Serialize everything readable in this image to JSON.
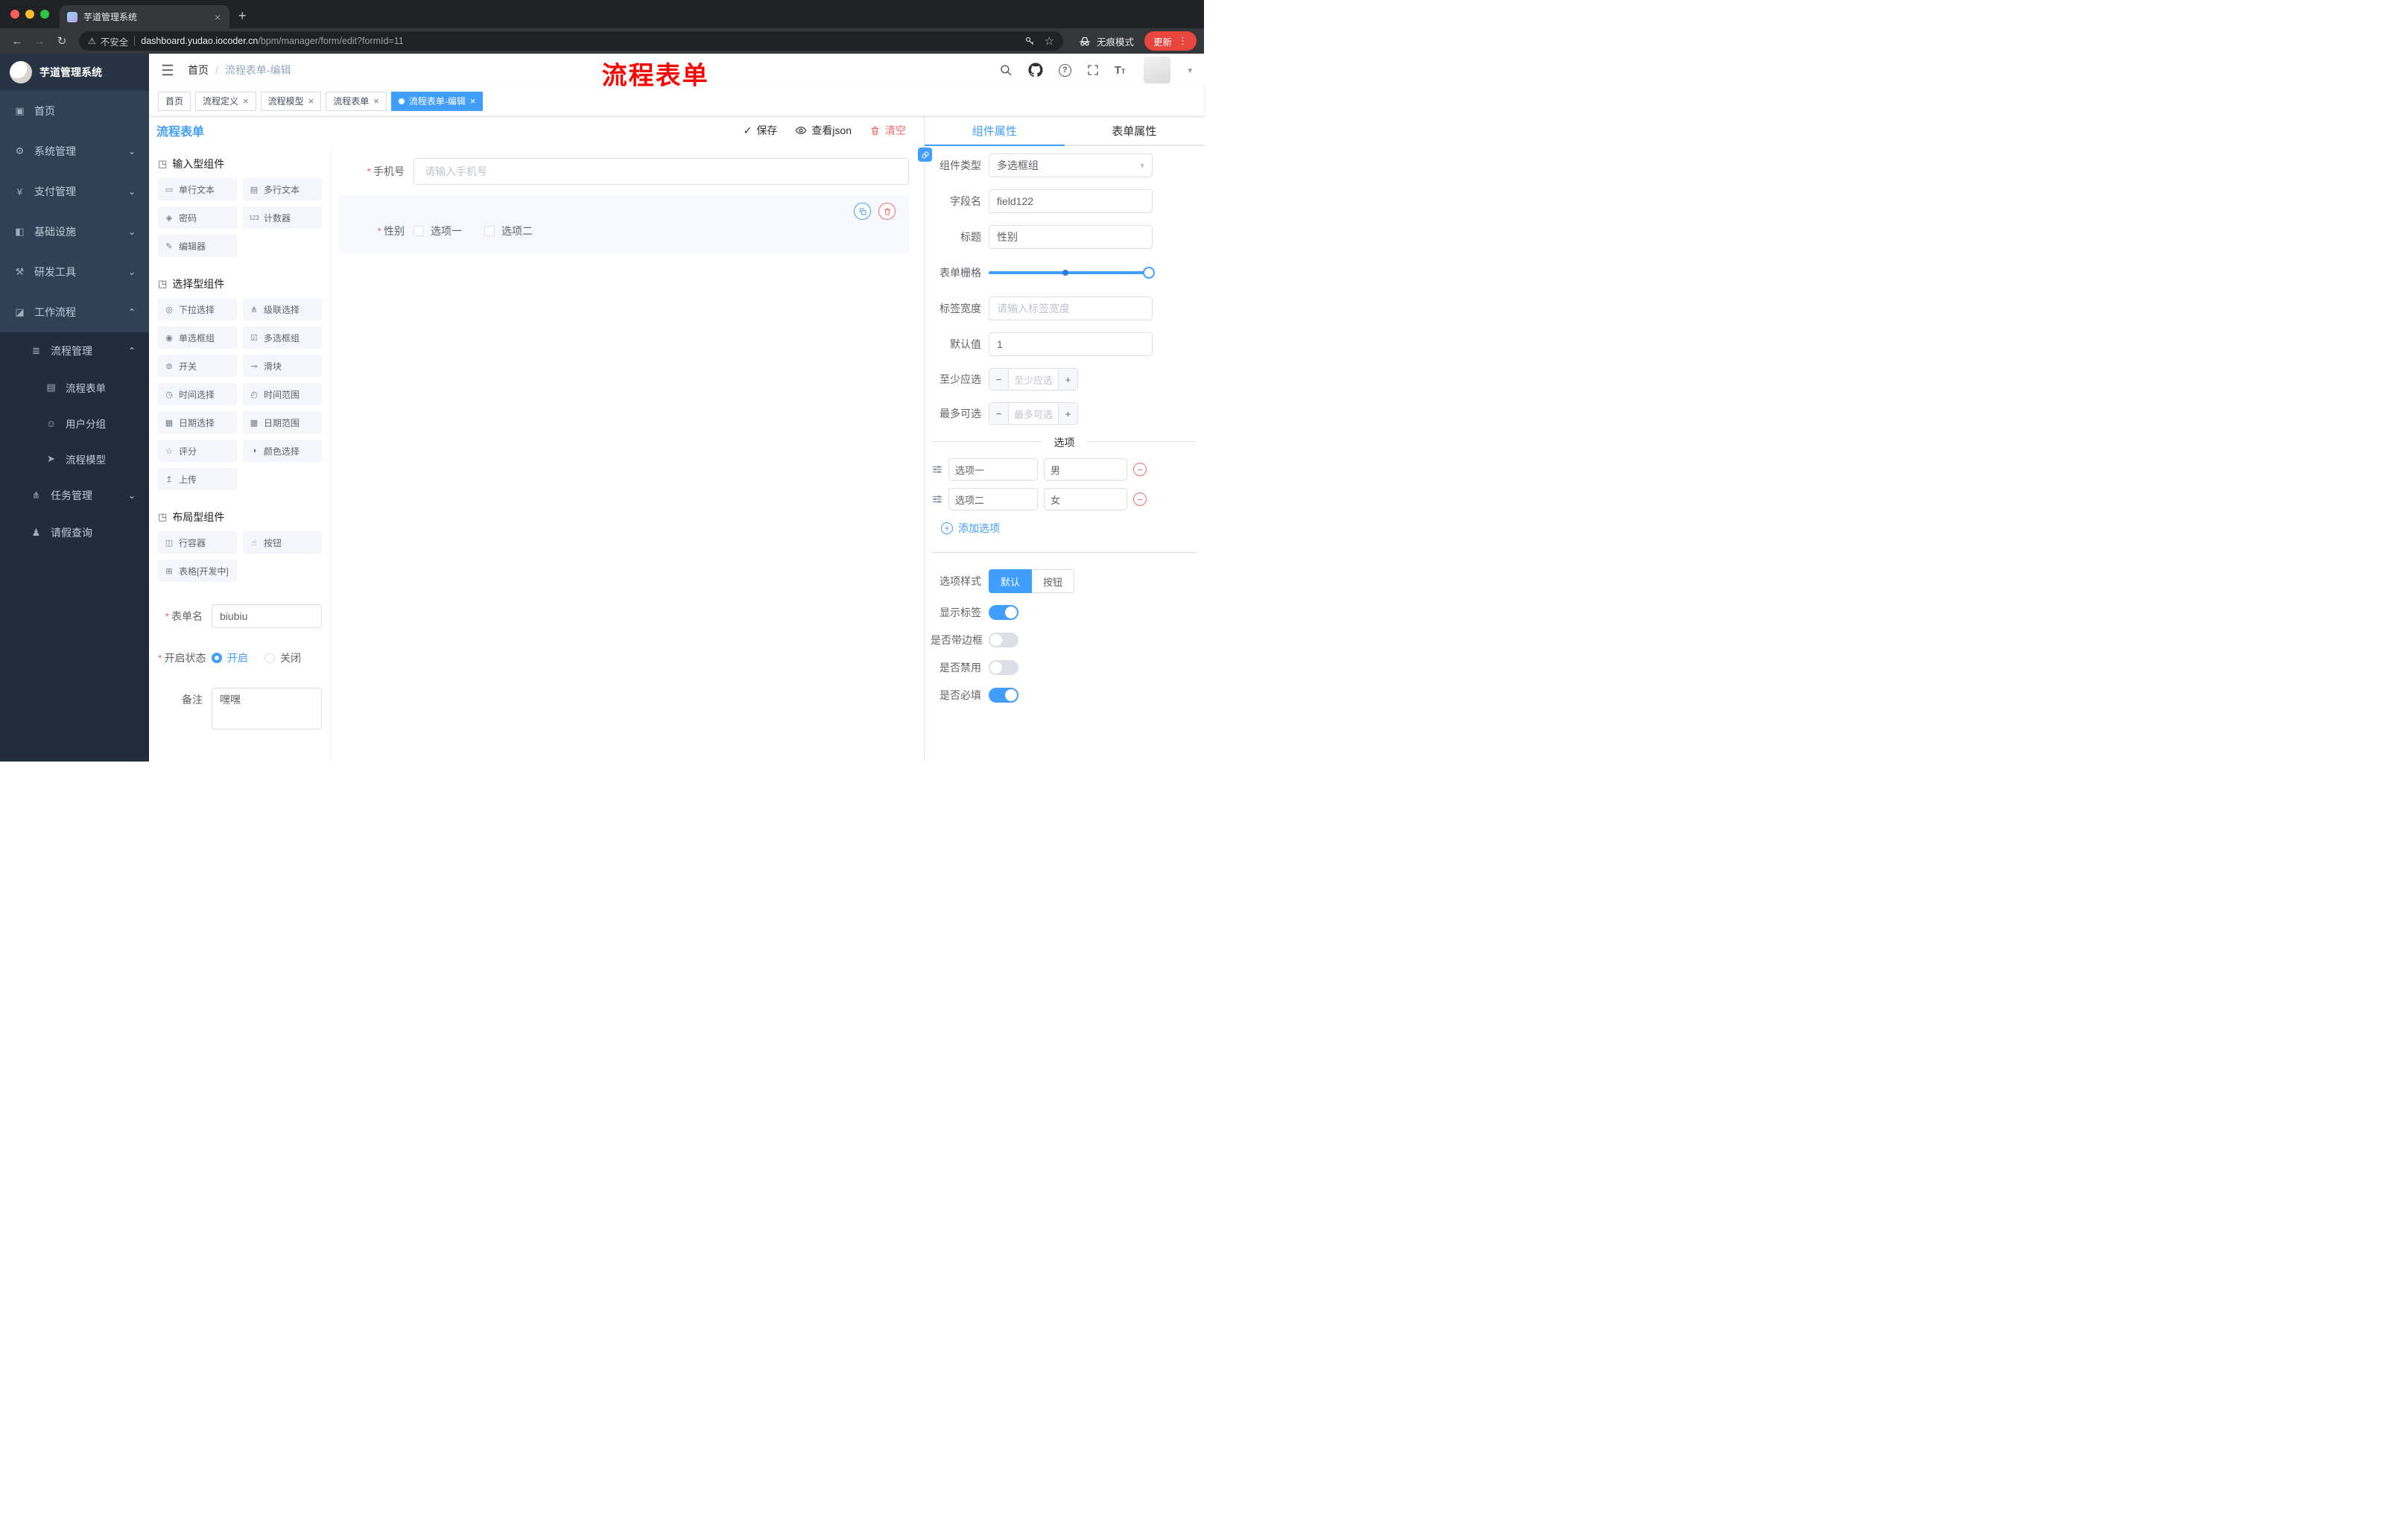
{
  "glyphs": {
    "back": "←",
    "forward": "→",
    "reload": "↻",
    "warning": "⚠",
    "dots": "⋮",
    "plus": "+",
    "close": "×",
    "star": "☆",
    "check": "✓",
    "caret_down": "▾",
    "chev_down": "⌄",
    "chev_up": "⌃",
    "minus": "−",
    "group": "◳",
    "input": "▭",
    "textarea": "▤",
    "password": "◈",
    "counter": "123",
    "editor": "✎",
    "select": "◎",
    "cascader": "⋔",
    "radio": "◉",
    "checkbox": "☑",
    "switch": "⊜",
    "slider": "⊸",
    "time": "◷",
    "time_range": "◴",
    "date": "▦",
    "date_range": "▩",
    "rate": "☆",
    "color": "◑",
    "upload": "↥",
    "row": "◫",
    "button": "☝",
    "table": "⊞",
    "home": "▣",
    "system": "⚙",
    "pay": "¥",
    "infra": "◧",
    "dev": "⚒",
    "workflow": "◪",
    "process_mgmt": "≣",
    "form_doc": "▤",
    "user_group": "☺",
    "model": "➤",
    "task": "⋔",
    "person": "♟"
  },
  "browser": {
    "tab_title": "芋道管理系统",
    "security": "不安全",
    "domain": "dashboard.yudao.iocoder.cn",
    "path": "/bpm/manager/form/edit?formId=11",
    "incognito": "无痕模式",
    "update_label": "更新"
  },
  "sidebar": {
    "logo_title": "芋道管理系统",
    "items": [
      {
        "label": "首页"
      },
      {
        "label": "系统管理"
      },
      {
        "label": "支付管理"
      },
      {
        "label": "基础设施"
      },
      {
        "label": "研发工具"
      },
      {
        "label": "工作流程"
      }
    ],
    "sub": {
      "process_mgmt": "流程管理",
      "process_form": "流程表单",
      "user_group": "用户分组",
      "process_model": "流程模型",
      "task_mgmt": "任务管理",
      "leave_query": "请假查询"
    }
  },
  "header": {
    "breadcrumb": [
      "首页",
      "流程表单-编辑"
    ],
    "annotation": "流程表单"
  },
  "tags": [
    {
      "label": "首页"
    },
    {
      "label": "流程定义"
    },
    {
      "label": "流程模型"
    },
    {
      "label": "流程表单"
    },
    {
      "label": "流程表单-编辑"
    }
  ],
  "designer": {
    "title": "流程表单",
    "actions": {
      "save": "保存",
      "view_json": "查看json",
      "clear": "清空"
    },
    "palette": {
      "groups": [
        {
          "title": "输入型组件"
        },
        {
          "title": "选择型组件"
        },
        {
          "title": "布局型组件"
        }
      ],
      "items": {
        "input": "单行文本",
        "textarea": "多行文本",
        "password": "密码",
        "counter": "计数器",
        "editor": "编辑器",
        "select": "下拉选择",
        "cascader": "级联选择",
        "radio_group": "单选框组",
        "checkbox_group": "多选框组",
        "switch": "开关",
        "slider": "滑块",
        "time": "时间选择",
        "time_range": "时间范围",
        "date": "日期选择",
        "date_range": "日期范围",
        "rate": "评分",
        "color": "颜色选择",
        "upload": "上传",
        "row": "行容器",
        "button": "按钮",
        "table": "表格[开发中]"
      }
    },
    "meta": {
      "form_name_label": "表单名",
      "form_name_value": "biubiu",
      "status_label": "开启状态",
      "status_on": "开启",
      "status_off": "关闭",
      "remark_label": "备注",
      "remark_value": "嘿嘿"
    },
    "canvas": {
      "phone": {
        "label": "手机号",
        "placeholder": "请输入手机号"
      },
      "gender": {
        "label": "性别",
        "options": [
          "选项一",
          "选项二"
        ]
      }
    }
  },
  "props": {
    "tabs": {
      "component": "组件属性",
      "form": "表单属性"
    },
    "rows": {
      "type_label": "组件类型",
      "type_value": "多选框组",
      "field_label": "字段名",
      "field_value": "field122",
      "title_label": "标题",
      "title_value": "性别",
      "grid_label": "表单栅格",
      "label_width_label": "标签宽度",
      "label_width_placeholder": "请输入标签宽度",
      "default_label": "默认值",
      "default_value": "1",
      "min_label": "至少应选",
      "min_placeholder": "至少应选",
      "max_label": "最多可选",
      "max_placeholder": "最多可选"
    },
    "options": {
      "title": "选项",
      "rows": [
        {
          "label": "选项一",
          "value": "男"
        },
        {
          "label": "选项二",
          "value": "女"
        }
      ],
      "add": "添加选项"
    },
    "style": {
      "label": "选项样式",
      "options": [
        {
          "label": "默认"
        },
        {
          "label": "按钮"
        }
      ]
    },
    "switches": [
      {
        "label": "显示标签",
        "state": "on"
      },
      {
        "label": "是否带边框",
        "state": "off"
      },
      {
        "label": "是否禁用",
        "state": "off"
      },
      {
        "label": "是否必填",
        "state": "on"
      }
    ]
  }
}
